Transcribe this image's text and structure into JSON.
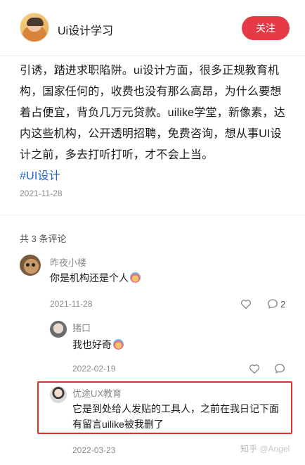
{
  "header": {
    "account_name": "Ui设计学习",
    "follow_label": "关注"
  },
  "post": {
    "text": "引诱，踏进求职陷阱。ui设计方面，很多正规教育机构，国家任何的，收费也没有那么高昂，为什么要想着占便宜，背负几万元贷款。uilike学堂，新像素，达内这些机构，公开透明招聘，免费咨询，想从事UI设计之前，多去打听打听，才不会上当。",
    "hashtag": "#UI设计",
    "date": "2021-11-28"
  },
  "comments_header": "共 3 条评论",
  "comments": [
    {
      "author": "昨夜小楼",
      "text": "你是机构还是个人",
      "date": "2021-11-28",
      "reply_count": "2"
    },
    {
      "author": "猪口",
      "text": "我也好奇",
      "date": "2022-02-19"
    },
    {
      "author": "优途UX教育",
      "text": "它是到处给人发贴的工具人，之前在我日记下面有留言uilike被我删了",
      "date": "2022-03-23"
    }
  ],
  "watermark": {
    "site": "知乎",
    "user": "@Angel"
  },
  "colors": {
    "accent": "#e53a46",
    "link": "#1f64d4",
    "highlight_border": "#e0312c",
    "muted_text": "#8a8a8a"
  },
  "icons": [
    "heart-icon",
    "comment-icon",
    "emoji-icon"
  ]
}
